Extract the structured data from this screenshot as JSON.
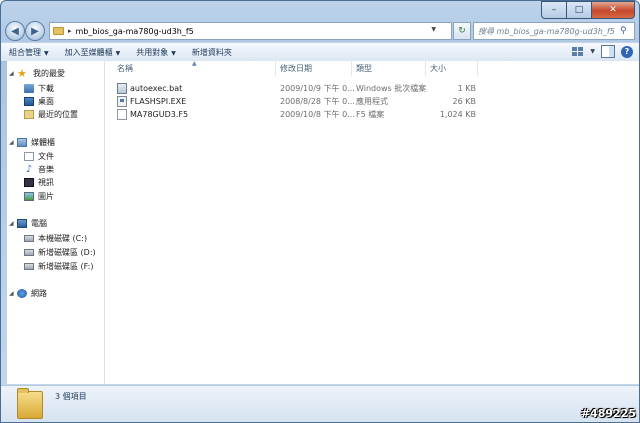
{
  "window": {
    "caption": {
      "minimize": "–",
      "maximize": "□",
      "close": "✕"
    }
  },
  "address": {
    "separator": "▸",
    "path": "mb_bios_ga-ma780g-ud3h_f5",
    "search_placeholder": "搜尋 mb_bios_ga-ma780g-ud3h_f5"
  },
  "toolbar": {
    "items": [
      "組合管理",
      "加入至媒體櫃",
      "共用對象",
      "新增資料夾"
    ]
  },
  "nav": {
    "favorites": {
      "label": "我的最愛",
      "items": [
        "下載",
        "桌面",
        "最近的位置"
      ]
    },
    "libraries": {
      "label": "媒體櫃",
      "items": [
        "文件",
        "音樂",
        "視訊",
        "圖片"
      ]
    },
    "computer": {
      "label": "電腦",
      "items": [
        "本機磁碟 (C:)",
        "新增磁碟區 (D:)",
        "新增磁碟區 (F:)"
      ]
    },
    "network": {
      "label": "網路"
    }
  },
  "columns": {
    "name": "名稱",
    "date": "修改日期",
    "type": "類型",
    "size": "大小"
  },
  "files": [
    {
      "name": "autoexec.bat",
      "date": "2009/10/9 下午 0...",
      "type": "Windows 批次檔案",
      "size": "1 KB",
      "icon": "batch-file-icon"
    },
    {
      "name": "FLASHSPI.EXE",
      "date": "2008/8/28 下午 0...",
      "type": "應用程式",
      "size": "26 KB",
      "icon": "exe-file-icon"
    },
    {
      "name": "MA78GUD3.F5",
      "date": "2009/10/8 下午 0...",
      "type": "F5 檔案",
      "size": "1,024 KB",
      "icon": "generic-file-icon"
    }
  ],
  "status": {
    "item_count": "3 個項目"
  },
  "watermark": "#489225"
}
